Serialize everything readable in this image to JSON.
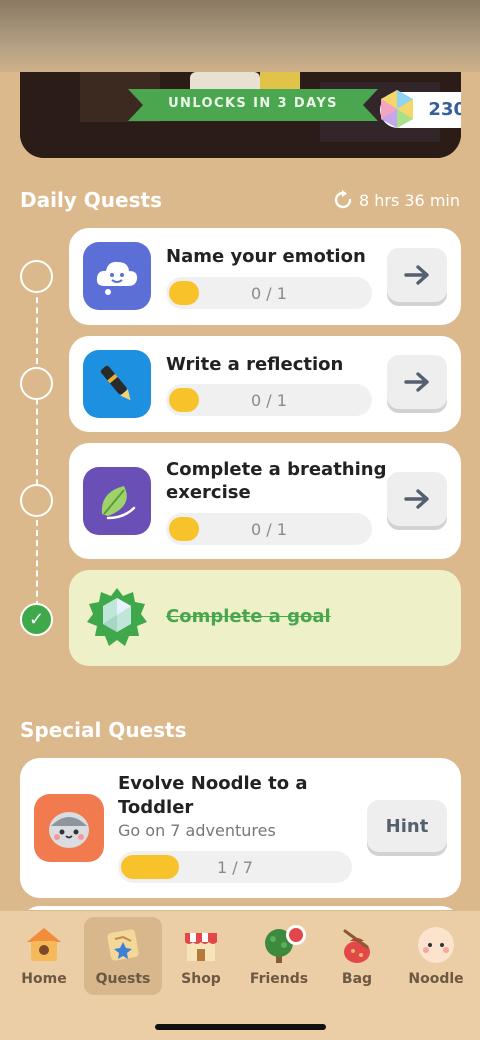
{
  "banner": {
    "unlock_text": "UNLOCKS IN 3 DAYS",
    "gem_count": "230"
  },
  "daily": {
    "title": "Daily Quests",
    "timer": "8 hrs 36 min",
    "quests": [
      {
        "title": "Name your emotion",
        "progress_text": "0 / 1",
        "progress": 0,
        "icon": "cloud-face-icon",
        "color": "#5c6fd6"
      },
      {
        "title": "Write a reflection",
        "progress_text": "0 / 1",
        "progress": 0,
        "icon": "pen-icon",
        "color": "#1e90e0"
      },
      {
        "title_line1": "Complete a breathing",
        "title_line2": "exercise",
        "progress_text": "0 / 1",
        "progress": 0,
        "icon": "leaf-icon",
        "color": "#6a4fb6"
      }
    ],
    "completed": {
      "title": "Complete a goal"
    }
  },
  "special": {
    "title": "Special Quests",
    "quest": {
      "title_line1": "Evolve Noodle to a",
      "title_line2": "Toddler",
      "subtitle": "Go on 7 adventures",
      "progress_text": "1 / 7",
      "progress": 0.14,
      "hint_label": "Hint"
    }
  },
  "tabs": [
    {
      "label": "Home"
    },
    {
      "label": "Quests",
      "active": true
    },
    {
      "label": "Shop"
    },
    {
      "label": "Friends",
      "badge": true
    },
    {
      "label": "Bag"
    },
    {
      "label": "Noodle"
    }
  ],
  "colors": {
    "background": "#dcb98c",
    "accent_green": "#47a64e",
    "progress_yellow": "#f7c22a"
  }
}
